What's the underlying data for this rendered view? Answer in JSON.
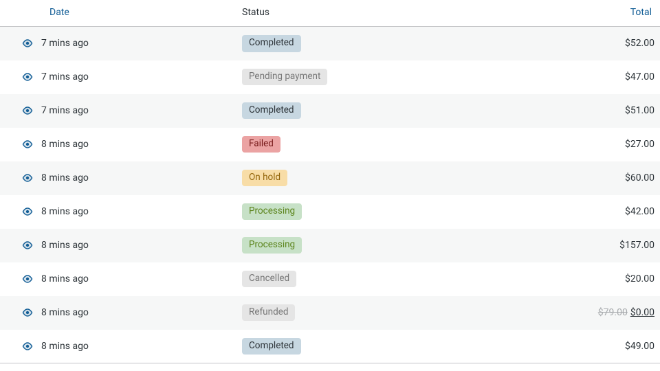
{
  "columns": {
    "date": "Date",
    "status": "Status",
    "total": "Total"
  },
  "status_labels": {
    "completed": "Completed",
    "pending": "Pending payment",
    "failed": "Failed",
    "onhold": "On hold",
    "processing": "Processing",
    "cancelled": "Cancelled",
    "refunded": "Refunded"
  },
  "rows": [
    {
      "date": "7 mins ago",
      "status": "completed",
      "total": "$52.00"
    },
    {
      "date": "7 mins ago",
      "status": "pending",
      "total": "$47.00"
    },
    {
      "date": "7 mins ago",
      "status": "completed",
      "total": "$51.00"
    },
    {
      "date": "8 mins ago",
      "status": "failed",
      "total": "$27.00"
    },
    {
      "date": "8 mins ago",
      "status": "onhold",
      "total": "$60.00"
    },
    {
      "date": "8 mins ago",
      "status": "processing",
      "total": "$42.00"
    },
    {
      "date": "8 mins ago",
      "status": "processing",
      "total": "$157.00"
    },
    {
      "date": "8 mins ago",
      "status": "cancelled",
      "total": "$20.00"
    },
    {
      "date": "8 mins ago",
      "status": "refunded",
      "total_strike": "$79.00",
      "total": "$0.00",
      "total_underline": true
    },
    {
      "date": "8 mins ago",
      "status": "completed",
      "total": "$49.00"
    }
  ]
}
